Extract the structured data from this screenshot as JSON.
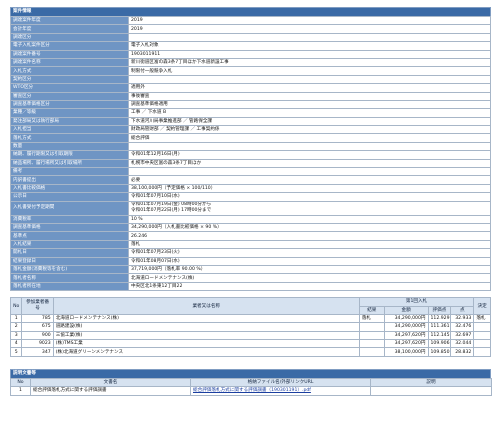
{
  "info_section_title": "案件情報",
  "info_rows": [
    {
      "label": "調達案件年度",
      "value": "2019"
    },
    {
      "label": "会計年度",
      "value": "2019"
    },
    {
      "label": "調達区分",
      "value": ""
    },
    {
      "label": "電子入札案件区分",
      "value": "電子入札対象"
    },
    {
      "label": "調達案件番号",
      "value": "1903011911"
    },
    {
      "label": "調達案件名称",
      "value": "新川街道区富の森3条7丁目ほか下水道新設工事"
    },
    {
      "label": "入札方式",
      "value": "制限付一般競争入札"
    },
    {
      "label": "契約区分",
      "value": ""
    },
    {
      "label": "WTO区分",
      "value": "適用外"
    },
    {
      "label": "審査区分",
      "value": "事後審査"
    },
    {
      "label": "調査基準価格区分",
      "value": "調査基準価格適用"
    },
    {
      "label": "業種／等級",
      "value": "工事 ／ 下水道 B"
    },
    {
      "label": "発注部局又は執行部局",
      "value": "下水道河川局事業推進部 ／ 管路保全課"
    },
    {
      "label": "入札担当",
      "value": "財政局管財部 ／ 契約管理課 ／ 工事契約係"
    },
    {
      "label": "落札方式",
      "value": "総合評価"
    },
    {
      "label": "数量",
      "value": ""
    },
    {
      "label": "納期、履行期限又は引取期限",
      "value": "令和01年12月16日(月)"
    },
    {
      "label": "納品場所、履行場所又は引取場所",
      "value": "札幌市中央区富の森3条7丁目ほか"
    },
    {
      "label": "備考",
      "value": ""
    },
    {
      "label": "内訳書提出",
      "value": "必要"
    },
    {
      "label": "入札書比較価格",
      "value": "38,100,000円（予定価格 × 100/110）"
    },
    {
      "label": "公示日",
      "value": "令和01年07月10日(水)"
    },
    {
      "label": "入札書受付予定期間",
      "value": "令和01年07月19日(金) 08時00分から",
      "value2": "令和01年07月22日(月) 17時00分まで"
    },
    {
      "label": "消費税率",
      "value": "10 %"
    },
    {
      "label": "調査基準価格",
      "value": "34,290,000円（入札書比較価格 × 90 %）"
    },
    {
      "label": "基準点",
      "value": "26.246"
    },
    {
      "label": "入札結果",
      "value": "落札"
    },
    {
      "label": "開札日",
      "value": "令和01年07月23日(火)"
    },
    {
      "label": "結果登録日",
      "value": "令和01年08月07日(水)"
    },
    {
      "label": "落札金額(消費税等を含む)",
      "value": "37,719,000円（落札率 90.00 %）"
    },
    {
      "label": "落札者名称",
      "value": "北海道ロードメンテナンス(株)"
    },
    {
      "label": "落札者所在地",
      "value": "中央区北1条東12丁目22"
    }
  ],
  "results": {
    "headers": {
      "no": "No",
      "bidder_no": "参加業者番号",
      "name": "業者又は名称",
      "round1": "第1回入札",
      "result": "結果",
      "amount": "金額",
      "eval_score": "評価点",
      "score": "点",
      "decision": "決定"
    },
    "rows": [
      {
        "no": "1",
        "bidder_no": "785",
        "name": "北海道ロードメンテナンス(株)",
        "result": "落札",
        "amount": "34,290,000円",
        "eval": "112.929",
        "score": "32.933",
        "decision": "落札"
      },
      {
        "no": "2",
        "bidder_no": "675",
        "name": "道路建設(株)",
        "result": "",
        "amount": "34,290,000円",
        "eval": "111.361",
        "score": "32.476",
        "decision": ""
      },
      {
        "no": "3",
        "bidder_no": "900",
        "name": "三協工業(株)",
        "result": "",
        "amount": "34,297,620円",
        "eval": "112.145",
        "score": "32.697",
        "decision": ""
      },
      {
        "no": "4",
        "bidder_no": "9023",
        "name": "(株)TMS工業",
        "result": "",
        "amount": "34,297,620円",
        "eval": "109.906",
        "score": "32.044",
        "decision": ""
      },
      {
        "no": "5",
        "bidder_no": "347",
        "name": "(株)北海道グリーンメンテナンス",
        "result": "",
        "amount": "38,100,000円",
        "eval": "109.850",
        "score": "28.832",
        "decision": ""
      }
    ]
  },
  "docs": {
    "section_title": "説明文書等",
    "headers": {
      "no": "No",
      "name": "文書名",
      "file": "格納ファイル名/外部リンクURL",
      "desc": "説明"
    },
    "rows": [
      {
        "no": "1",
        "name": "総合評価落札方式に関する評価調書",
        "file": "総合評価落札方式に関する評価調書（190301191）.pdf",
        "desc": ""
      }
    ]
  }
}
